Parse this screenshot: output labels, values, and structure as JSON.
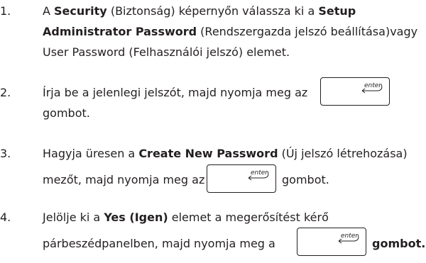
{
  "steps": [
    {
      "number": "1.",
      "lines": [
        [
          "A ",
          "Security",
          " (Biztonság) képernyőn válassza ki a ",
          "Setup"
        ],
        [
          "Administrator Password",
          " (Rendszergazda jelszó beállítása)vagy"
        ],
        [
          "User Password (Felhasználói jelszó) elemet."
        ]
      ]
    },
    {
      "number": "2.",
      "lines": [
        [
          "Írja be a jelenlegi jelszót, majd nyomja meg az"
        ],
        [
          "gombot."
        ]
      ]
    },
    {
      "number": "3.",
      "lines": [
        [
          "Hagyja üresen a ",
          "Create New Password",
          " (Új jelszó létrehozása)"
        ],
        [
          "mezőt, majd nyomja meg az",
          "gombot."
        ]
      ]
    },
    {
      "number": "4.",
      "lines": [
        [
          "Jelölje ki a ",
          "Yes (Igen)",
          " elemet a megerősítést kérő"
        ],
        [
          "párbeszédpanelben, majd nyomja meg a",
          "gombot."
        ]
      ]
    }
  ],
  "key_label": "enter"
}
